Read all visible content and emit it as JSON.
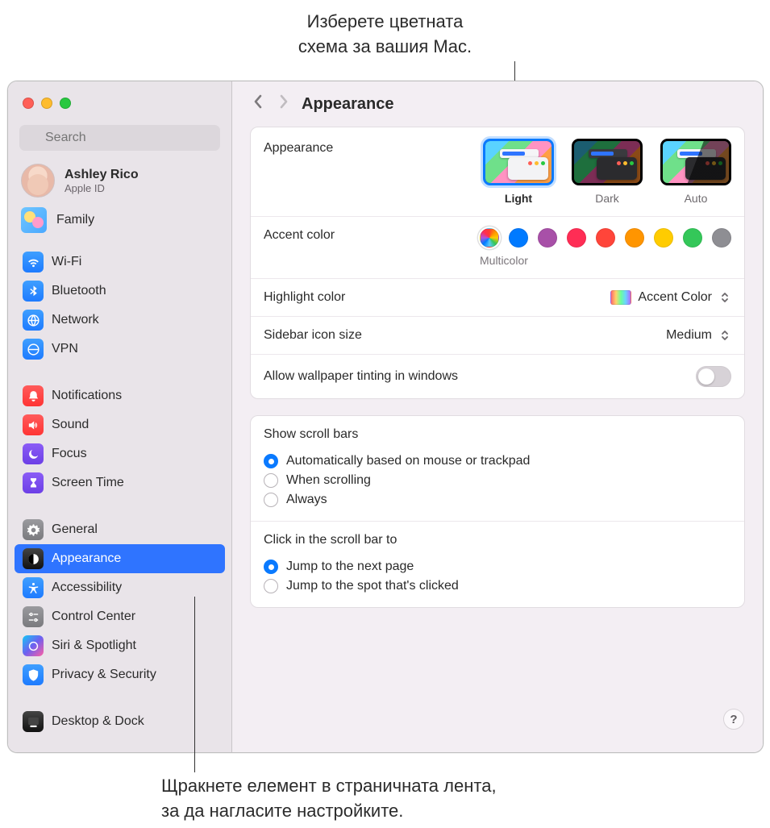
{
  "callouts": {
    "top_line1": "Изберете цветната",
    "top_line2": "схема за вашия Mac.",
    "bottom_line1": "Щракнете елемент в страничната лента,",
    "bottom_line2": "за да нагласите настройките."
  },
  "search": {
    "placeholder": "Search"
  },
  "account": {
    "name": "Ashley Rico",
    "sub": "Apple ID"
  },
  "family": {
    "label": "Family"
  },
  "sidebar": {
    "groups": [
      {
        "items": [
          {
            "label": "Wi-Fi",
            "icon": "wifi",
            "color": "blue"
          },
          {
            "label": "Bluetooth",
            "icon": "bluetooth",
            "color": "blue"
          },
          {
            "label": "Network",
            "icon": "network",
            "color": "blue"
          },
          {
            "label": "VPN",
            "icon": "vpn",
            "color": "blue"
          }
        ]
      },
      {
        "items": [
          {
            "label": "Notifications",
            "icon": "bell",
            "color": "red"
          },
          {
            "label": "Sound",
            "icon": "sound",
            "color": "red"
          },
          {
            "label": "Focus",
            "icon": "moon",
            "color": "purple"
          },
          {
            "label": "Screen Time",
            "icon": "hourglass",
            "color": "purple"
          }
        ]
      },
      {
        "items": [
          {
            "label": "General",
            "icon": "gear",
            "color": "gray"
          },
          {
            "label": "Appearance",
            "icon": "appearance",
            "color": "black",
            "active": true
          },
          {
            "label": "Accessibility",
            "icon": "accessibility",
            "color": "blue"
          },
          {
            "label": "Control Center",
            "icon": "control",
            "color": "gray"
          },
          {
            "label": "Siri & Spotlight",
            "icon": "siri",
            "color": "siri"
          },
          {
            "label": "Privacy & Security",
            "icon": "privacy",
            "color": "blue"
          }
        ]
      },
      {
        "items": [
          {
            "label": "Desktop & Dock",
            "icon": "dock",
            "color": "black"
          }
        ]
      }
    ]
  },
  "header": {
    "title": "Appearance"
  },
  "panel1": {
    "appearance_label": "Appearance",
    "thumbs": {
      "light": "Light",
      "dark": "Dark",
      "auto": "Auto"
    },
    "accent_label": "Accent color",
    "accent_selected_label": "Multicolor",
    "accent_colors": [
      "#007aff",
      "#a850a8",
      "#ff2d55",
      "#ff453a",
      "#ff9500",
      "#ffcc00",
      "#34c759",
      "#8e8e93"
    ],
    "highlight_label": "Highlight color",
    "highlight_value": "Accent Color",
    "icon_size_label": "Sidebar icon size",
    "icon_size_value": "Medium",
    "tinting_label": "Allow wallpaper tinting in windows"
  },
  "panel2": {
    "scroll_title": "Show scroll bars",
    "scroll_options": [
      "Automatically based on mouse or trackpad",
      "When scrolling",
      "Always"
    ],
    "scroll_selected": 0,
    "click_title": "Click in the scroll bar to",
    "click_options": [
      "Jump to the next page",
      "Jump to the spot that's clicked"
    ],
    "click_selected": 0
  },
  "help": "?"
}
